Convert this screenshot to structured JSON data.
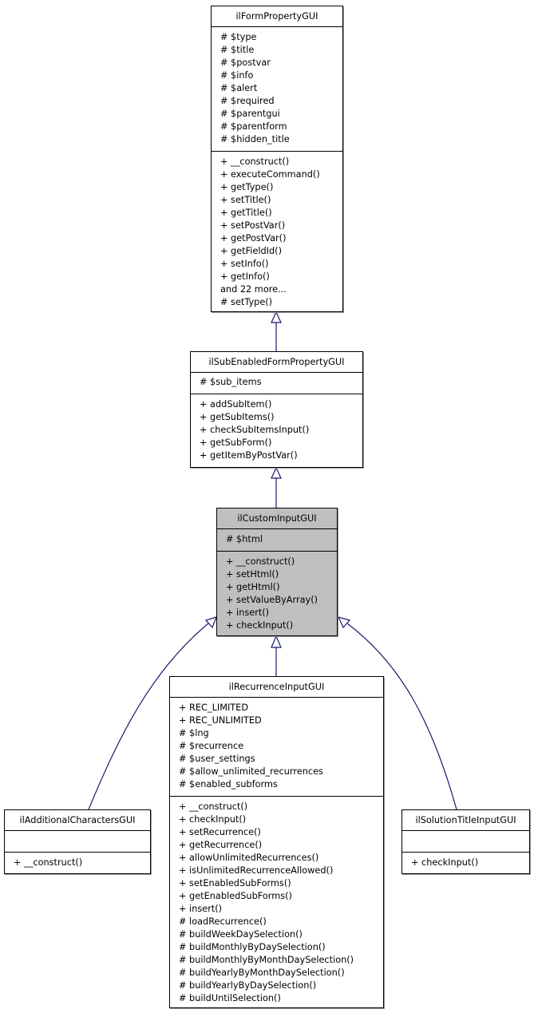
{
  "diagram": {
    "type": "uml-class-inheritance",
    "edge_color": "#191970",
    "highlight_color": "#bfbfbf",
    "classes": [
      {
        "id": "ilFormPropertyGUI",
        "name": "ilFormPropertyGUI",
        "highlighted": false,
        "attributes": [
          "# $type",
          "# $title",
          "# $postvar",
          "# $info",
          "# $alert",
          "# $required",
          "# $parentgui",
          "# $parentform",
          "# $hidden_title"
        ],
        "methods": [
          "+ __construct()",
          "+ executeCommand()",
          "+ getType()",
          "+ setTitle()",
          "+ getTitle()",
          "+ setPostVar()",
          "+ getPostVar()",
          "+ getFieldId()",
          "+ setInfo()",
          "+ getInfo()",
          "and 22 more...",
          "# setType()"
        ]
      },
      {
        "id": "ilSubEnabledFormPropertyGUI",
        "name": "ilSubEnabledFormPropertyGUI",
        "highlighted": false,
        "attributes": [
          "# $sub_items"
        ],
        "methods": [
          "+ addSubItem()",
          "+ getSubItems()",
          "+ checkSubItemsInput()",
          "+ getSubForm()",
          "+ getItemByPostVar()"
        ]
      },
      {
        "id": "ilCustomInputGUI",
        "name": "ilCustomInputGUI",
        "highlighted": true,
        "attributes": [
          "# $html"
        ],
        "methods": [
          "+ __construct()",
          "+ setHtml()",
          "+ getHtml()",
          "+ setValueByArray()",
          "+ insert()",
          "+ checkInput()"
        ]
      },
      {
        "id": "ilRecurrenceInputGUI",
        "name": "ilRecurrenceInputGUI",
        "highlighted": false,
        "attributes": [
          "+ REC_LIMITED",
          "+ REC_UNLIMITED",
          "# $lng",
          "# $recurrence",
          "# $user_settings",
          "# $allow_unlimited_recurrences",
          "# $enabled_subforms"
        ],
        "methods": [
          "+ __construct()",
          "+ checkInput()",
          "+ setRecurrence()",
          "+ getRecurrence()",
          "+ allowUnlimitedRecurrences()",
          "+ isUnlimitedRecurrenceAllowed()",
          "+ setEnabledSubForms()",
          "+ getEnabledSubForms()",
          "+ insert()",
          "# loadRecurrence()",
          "# buildWeekDaySelection()",
          "# buildMonthlyByDaySelection()",
          "# buildMonthlyByMonthDaySelection()",
          "# buildYearlyByMonthDaySelection()",
          "# buildYearlyByDaySelection()",
          "# buildUntilSelection()"
        ]
      },
      {
        "id": "ilAdditionalCharactersGUI",
        "name": "ilAdditionalCharactersGUI",
        "highlighted": false,
        "attributes": [],
        "methods": [
          "+ __construct()"
        ]
      },
      {
        "id": "ilSolutionTitleInputGUI",
        "name": "ilSolutionTitleInputGUI",
        "highlighted": false,
        "attributes": [],
        "methods": [
          "+ checkInput()"
        ]
      }
    ],
    "inheritance": [
      {
        "child": "ilSubEnabledFormPropertyGUI",
        "parent": "ilFormPropertyGUI"
      },
      {
        "child": "ilCustomInputGUI",
        "parent": "ilSubEnabledFormPropertyGUI"
      },
      {
        "child": "ilRecurrenceInputGUI",
        "parent": "ilCustomInputGUI"
      },
      {
        "child": "ilAdditionalCharactersGUI",
        "parent": "ilCustomInputGUI"
      },
      {
        "child": "ilSolutionTitleInputGUI",
        "parent": "ilCustomInputGUI"
      }
    ]
  }
}
